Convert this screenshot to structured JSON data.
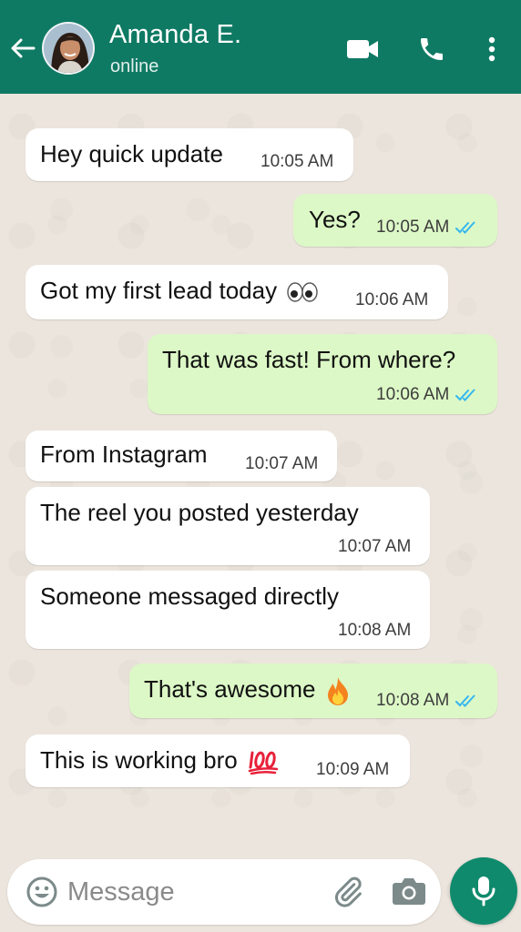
{
  "header": {
    "contact_name": "Amanda E.",
    "status": "online",
    "color": "#0f7a64"
  },
  "messages": [
    {
      "direction": "in",
      "text": "Hey quick update",
      "time": "10:05 AM"
    },
    {
      "direction": "out",
      "text": "Yes?",
      "time": "10:05 AM",
      "read": true
    },
    {
      "direction": "in",
      "text": "Got my first lead today",
      "emoji": "eyes-emoji",
      "time": "10:06 AM"
    },
    {
      "direction": "out",
      "text": "That was fast! From where?",
      "time": "10:06 AM",
      "read": true
    },
    {
      "direction": "in",
      "text": "From Instagram",
      "time": "10:07 AM"
    },
    {
      "direction": "in",
      "text": "The reel you posted yesterday",
      "time": "10:07 AM"
    },
    {
      "direction": "in",
      "text": "Someone messaged directly",
      "time": "10:08 AM"
    },
    {
      "direction": "out",
      "text": "That's awesome",
      "emoji": "fire-emoji",
      "time": "10:08 AM",
      "read": true
    },
    {
      "direction": "in",
      "text": "This is working bro",
      "emoji": "hundred-points-emoji",
      "time": "10:09 AM"
    }
  ],
  "composer": {
    "placeholder": "Message"
  },
  "colors": {
    "incoming": "#ffffff",
    "outgoing": "#dcf8c6",
    "read_tick": "#34b7f1",
    "mic": "#0f8a6c"
  }
}
